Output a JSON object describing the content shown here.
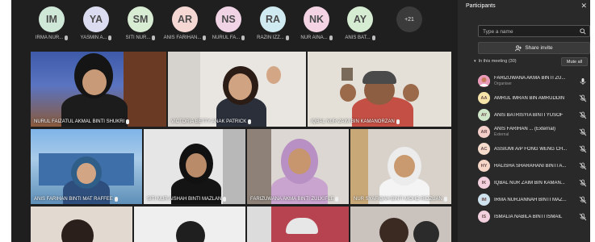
{
  "strip": {
    "avatars": [
      {
        "initials": "IM",
        "name": "IRMA NUR...",
        "color": "#cfe7d7"
      },
      {
        "initials": "YA",
        "name": "YASMIN A...",
        "color": "#dcdcf0"
      },
      {
        "initials": "SM",
        "name": "SITI NUR...",
        "color": "#d8ecd4"
      },
      {
        "initials": "AR",
        "name": "ANIS FARIHAN...",
        "color": "#f5d8d4"
      },
      {
        "initials": "NS",
        "name": "NURUL FA...",
        "color": "#f1d3e6"
      },
      {
        "initials": "RA",
        "name": "RAZIN IZZ...",
        "color": "#cfeaf0"
      },
      {
        "initials": "NK",
        "name": "NUR AINA...",
        "color": "#f3d3e4"
      },
      {
        "initials": "AY",
        "name": "ANIS BAT...",
        "color": "#d6ecd2"
      }
    ],
    "more": "+21"
  },
  "tiles": [
    {
      "label": "NURUL FAIZATUL AKMAL BINTI SHUKRI"
    },
    {
      "label": "VICTORIA BETTY ANAK PATRICK"
    },
    {
      "label": "IQBAL NUR ZAIM BIN KAMANORZAN"
    },
    {
      "label": "ANIS FARIHAN BINTI MAT RAFFEE"
    },
    {
      "label": "SITI NUR AISHAH BINTI MAZLAN"
    },
    {
      "label": "FARIZUWANA AKMA BINTI ZULKIFLE"
    },
    {
      "label": "NUR SYAFIQAH BINTI MOHD RIDZUAN"
    },
    {
      "label": ""
    },
    {
      "label": ""
    },
    {
      "label": ""
    },
    {
      "label": ""
    }
  ],
  "panel": {
    "title": "Participants",
    "search_placeholder": "Type a name",
    "share_label": "Share invite",
    "in_meeting": "In this meeting (30)",
    "mute_all": "Mute all",
    "participants": [
      {
        "initials": "",
        "name": "FARIZUWANA AKMA BINTI ZU...",
        "role": "Organiser",
        "color": "#e89bb8",
        "photo": true,
        "mic": "on"
      },
      {
        "initials": "AA",
        "name": "AMRUL IMRAN BIN AMRUDDIN",
        "role": "",
        "color": "#f6e4a9",
        "mic": "off"
      },
      {
        "initials": "AY",
        "name": "ANIS BATRISYIA BINTI YUSOF",
        "role": "",
        "color": "#cfe6c8",
        "mic": "off"
      },
      {
        "initials": "AR",
        "name": "ANIS FARIHAN ... (External)",
        "role": "External",
        "color": "#f4cfc9",
        "mic": "off"
      },
      {
        "initials": "AC",
        "name": "ASSIUMI A/P FONG WENG CH...",
        "role": "",
        "color": "#f6dccd",
        "mic": "off"
      },
      {
        "initials": "HY",
        "name": "HALISHA SHARAHANI BINTI A...",
        "role": "",
        "color": "#f6d6c6",
        "mic": "off"
      },
      {
        "initials": "IK",
        "name": "IQBAL NUR ZAIM BIN KAMAN...",
        "role": "",
        "color": "#f3d0de",
        "mic": "off"
      },
      {
        "initials": "IM",
        "name": "IRMA NURJANNAH BINTI MAZ...",
        "role": "",
        "color": "#cfe3ee",
        "mic": "off"
      },
      {
        "initials": "IS",
        "name": "ISMALIA NABILA BINTI ISMAIL",
        "role": "",
        "color": "#f3d0de",
        "mic": "off"
      }
    ]
  }
}
